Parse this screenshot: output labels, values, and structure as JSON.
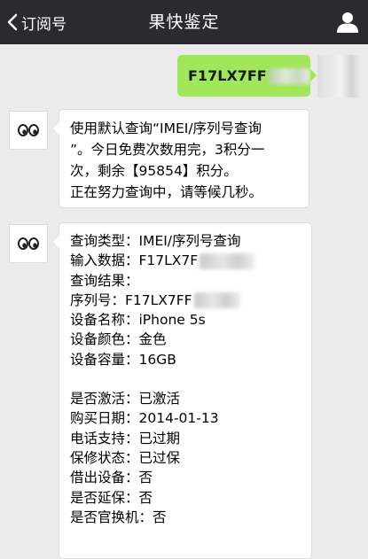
{
  "header": {
    "back_label": "订阅号",
    "title": "果快鉴定",
    "user_icon": "user-icon"
  },
  "outgoing": {
    "text": "F17LX7FF"
  },
  "message1": {
    "lines": [
      "使用默认查询“IMEI/序列号查询",
      "”。今日免费次数用完，3积分一",
      "次，剩余【95854】积分。",
      "正在努力查询中，请等候几秒。"
    ]
  },
  "message2": {
    "query_type": "查询类型：IMEI/序列号查询",
    "input_data": "输入数据：F17LX7F",
    "result": "查询结果：",
    "serial": "序列号：F17LX7FF",
    "device_name": "设备名称：iPhone 5s",
    "device_color": "设备颜色：金色",
    "device_capacity": "设备容量：16GB",
    "activated": "是否激活：已激活",
    "purchase_date": "购买日期：2014-01-13",
    "phone_support": "电话支持：已过期",
    "warranty": "保修状态：已过保",
    "loaner": "借出设备：否",
    "extended": "是否延保：否",
    "replaced": "是否官换机：否"
  },
  "colors": {
    "header_bg": "#2b2b2f",
    "chat_bg": "#ebebeb",
    "outgoing_bubble": "#a0e75a",
    "incoming_bubble": "#ffffff"
  }
}
